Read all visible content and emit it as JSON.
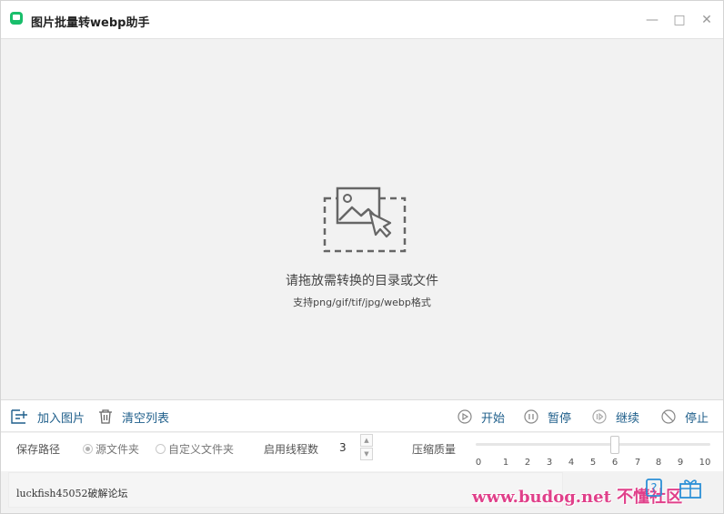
{
  "window": {
    "title": "图片批量转webp助手",
    "controls": {
      "minimize": "—",
      "maximize": "□",
      "close": "✕"
    }
  },
  "drop_area": {
    "main_text": "请拖放需转换的目录或文件",
    "sub_text": "支持png/gif/tif/jpg/webp格式",
    "icon": "image-drop-icon"
  },
  "toolbar": {
    "add_images": "加入图片",
    "clear_list": "清空列表",
    "start": "开始",
    "pause": "暂停",
    "resume": "继续",
    "stop": "停止"
  },
  "settings": {
    "save_path_label": "保存路径",
    "option_source": "源文件夹",
    "option_custom": "自定义文件夹",
    "selected_option": "源文件夹",
    "threads_label": "启用线程数",
    "threads_value": "3",
    "quality_label": "压缩质量",
    "quality_value": 6,
    "quality_ticks": [
      "0",
      "1",
      "2",
      "3",
      "4",
      "5",
      "6",
      "7",
      "8",
      "9",
      "10"
    ]
  },
  "log": {
    "text": "luckfish45052破解论坛"
  },
  "watermark": "www.budog.net 不懂社区",
  "colors": {
    "accent": "#1f5f8b",
    "app_icon": "#19be6b",
    "watermark": "#e0408a"
  }
}
